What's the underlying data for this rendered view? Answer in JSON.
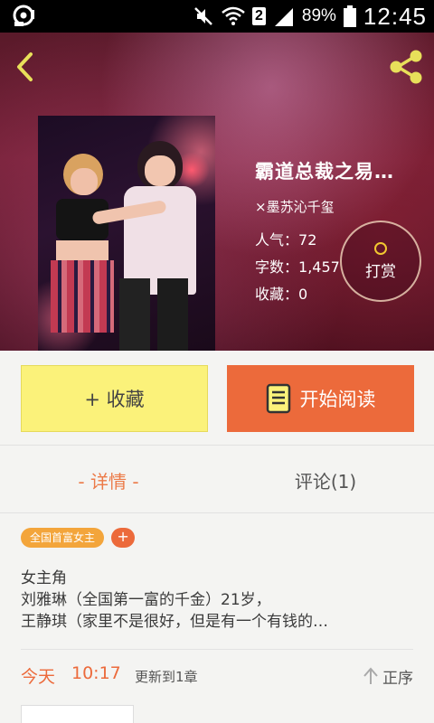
{
  "status_bar": {
    "sim_slot": "2",
    "battery_percent": "89%",
    "time": "12:45"
  },
  "header": {
    "back_icon": "chevron-left-icon",
    "share_icon": "share-icon",
    "accent_color": "#e8e05a"
  },
  "book": {
    "title": "霸道总裁之易…",
    "author": "×墨苏沁千玺",
    "popularity_label": "人气：",
    "popularity_value": "72",
    "word_count_label": "字数：",
    "word_count_value": "1,457",
    "collections_label": "收藏：",
    "collections_value": "0",
    "reward_label": "打赏"
  },
  "actions": {
    "favorite_label": "+ 收藏",
    "read_label": "开始阅读",
    "favorite_color": "#fbf27a",
    "read_color": "#ec6a3b"
  },
  "tabs": [
    {
      "label": "- 详情 -",
      "active": true
    },
    {
      "label": "评论(1)",
      "active": false
    }
  ],
  "detail": {
    "tags": [
      "全国首富女主"
    ],
    "add_tag_label": "+",
    "description_lines": [
      "女主角",
      "刘雅琳（全国第一富的千金）21岁，",
      "王静琪（家里不是很好，但是有一个有钱的…"
    ]
  },
  "update": {
    "day": "今天",
    "time": "10:17",
    "text": "更新到1章",
    "order_label": "正序"
  }
}
